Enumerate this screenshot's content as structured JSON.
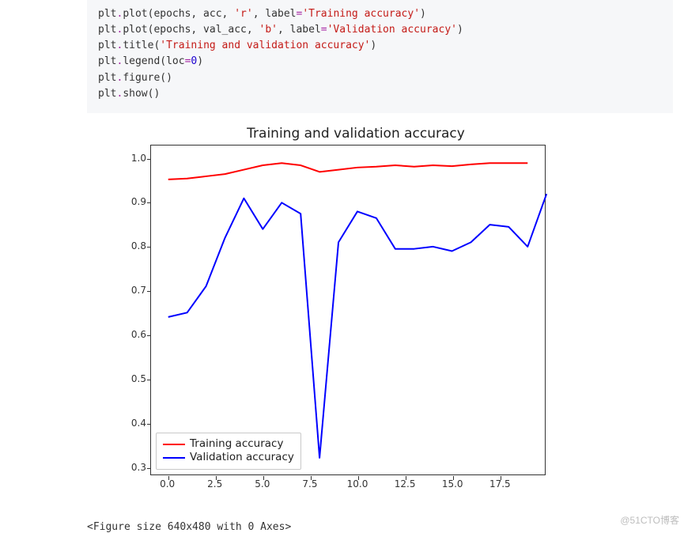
{
  "code": {
    "lines": [
      [
        {
          "t": "plt",
          "c": "obj"
        },
        {
          "t": ".",
          "c": "op"
        },
        {
          "t": "plot(epochs, acc, ",
          "c": "obj"
        },
        {
          "t": "'r'",
          "c": "str"
        },
        {
          "t": ", label",
          "c": "obj"
        },
        {
          "t": "=",
          "c": "op"
        },
        {
          "t": "'Training accuracy'",
          "c": "str"
        },
        {
          "t": ")",
          "c": "obj"
        }
      ],
      [
        {
          "t": "plt",
          "c": "obj"
        },
        {
          "t": ".",
          "c": "op"
        },
        {
          "t": "plot(epochs, val_acc, ",
          "c": "obj"
        },
        {
          "t": "'b'",
          "c": "str"
        },
        {
          "t": ", label",
          "c": "obj"
        },
        {
          "t": "=",
          "c": "op"
        },
        {
          "t": "'Validation accuracy'",
          "c": "str"
        },
        {
          "t": ")",
          "c": "obj"
        }
      ],
      [
        {
          "t": "plt",
          "c": "obj"
        },
        {
          "t": ".",
          "c": "op"
        },
        {
          "t": "title(",
          "c": "obj"
        },
        {
          "t": "'Training and validation accuracy'",
          "c": "str"
        },
        {
          "t": ")",
          "c": "obj"
        }
      ],
      [
        {
          "t": "plt",
          "c": "obj"
        },
        {
          "t": ".",
          "c": "op"
        },
        {
          "t": "legend(loc",
          "c": "obj"
        },
        {
          "t": "=",
          "c": "op"
        },
        {
          "t": "0",
          "c": "num"
        },
        {
          "t": ")",
          "c": "obj"
        }
      ],
      [
        {
          "t": "plt",
          "c": "obj"
        },
        {
          "t": ".",
          "c": "op"
        },
        {
          "t": "figure()",
          "c": "obj"
        }
      ],
      [
        {
          "t": "plt",
          "c": "obj"
        },
        {
          "t": ".",
          "c": "op"
        },
        {
          "t": "show()",
          "c": "obj"
        }
      ]
    ]
  },
  "chart_data": {
    "type": "line",
    "title": "Training and validation accuracy",
    "xlabel": "",
    "ylabel": "",
    "xlim": [
      -0.9,
      19.9
    ],
    "ylim": [
      0.282,
      1.03
    ],
    "x": [
      0,
      1,
      2,
      3,
      4,
      5,
      6,
      7,
      8,
      9,
      10,
      11,
      12,
      13,
      14,
      15,
      16,
      17,
      18,
      19
    ],
    "series": [
      {
        "name": "Training accuracy",
        "color": "#ff0000",
        "values": [
          0.953,
          0.955,
          0.96,
          0.965,
          0.975,
          0.985,
          0.99,
          0.985,
          0.97,
          0.975,
          0.98,
          0.982,
          0.985,
          0.982,
          0.985,
          0.983,
          0.987,
          0.99,
          0.99,
          0.99
        ]
      },
      {
        "name": "Validation accuracy",
        "color": "#0000ff",
        "values": [
          0.64,
          0.65,
          0.71,
          0.82,
          0.91,
          0.84,
          0.9,
          0.875,
          0.32,
          0.81,
          0.88,
          0.865,
          0.795,
          0.795,
          0.8,
          0.79,
          0.81,
          0.85,
          0.845,
          0.8,
          0.92
        ]
      }
    ],
    "x_ticks": [
      "0.0",
      "2.5",
      "5.0",
      "7.5",
      "10.0",
      "12.5",
      "15.0",
      "17.5"
    ],
    "x_tick_vals": [
      0,
      2.5,
      5.0,
      7.5,
      10.0,
      12.5,
      15.0,
      17.5
    ],
    "y_ticks": [
      "0.3",
      "0.4",
      "0.5",
      "0.6",
      "0.7",
      "0.8",
      "0.9",
      "1.0"
    ],
    "y_tick_vals": [
      0.3,
      0.4,
      0.5,
      0.6,
      0.7,
      0.8,
      0.9,
      1.0
    ],
    "legend_position": "lower-left"
  },
  "legend": {
    "items": [
      {
        "label": "Training accuracy",
        "color": "#ff0000"
      },
      {
        "label": "Validation accuracy",
        "color": "#0000ff"
      }
    ]
  },
  "output_text": "<Figure size 640x480 with 0 Axes>",
  "watermark": "@51CTO博客"
}
